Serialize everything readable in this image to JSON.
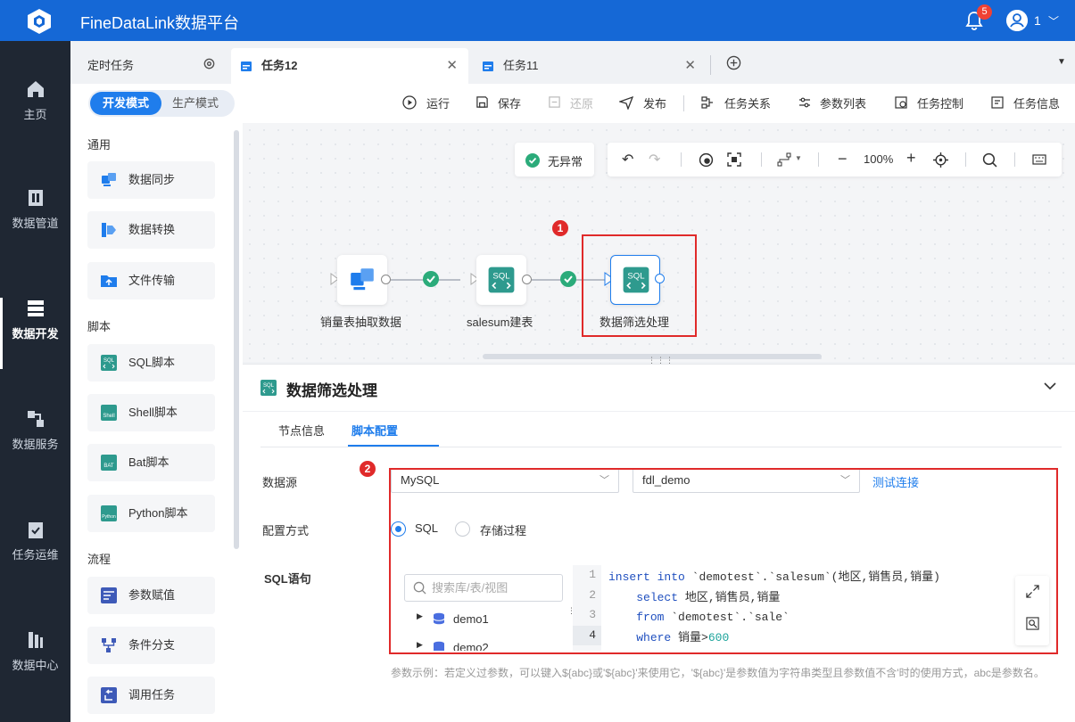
{
  "app": {
    "title": "FineDataLink数据平台",
    "badge": "5",
    "user": "1"
  },
  "nav": {
    "items": [
      {
        "label": "主页",
        "icon": "home-icon"
      },
      {
        "label": "数据管道",
        "icon": "pipeline-icon"
      },
      {
        "label": "数据开发",
        "icon": "dev-icon"
      },
      {
        "label": "数据服务",
        "icon": "service-icon"
      },
      {
        "label": "任务运维",
        "icon": "ops-icon"
      },
      {
        "label": "数据中心",
        "icon": "datacenter-icon"
      }
    ]
  },
  "tabs": {
    "scheduled": "定时任务",
    "items": [
      {
        "label": "任务12"
      },
      {
        "label": "任务11"
      }
    ]
  },
  "toolbar": {
    "mode_dev": "开发模式",
    "mode_prod": "生产模式",
    "run": "运行",
    "save": "保存",
    "restore": "还原",
    "publish": "发布",
    "relation": "任务关系",
    "params": "参数列表",
    "control": "任务控制",
    "info": "任务信息"
  },
  "palette": {
    "general": "通用",
    "script": "脚本",
    "flow": "流程",
    "general_items": [
      "数据同步",
      "数据转换",
      "文件传输"
    ],
    "script_items": [
      "SQL脚本",
      "Shell脚本",
      "Bat脚本",
      "Python脚本"
    ],
    "flow_items": [
      "参数赋值",
      "条件分支",
      "调用任务"
    ]
  },
  "canvas": {
    "status": "无异常",
    "zoom": "100%",
    "nodes": [
      "销量表抽取数据",
      "salesum建表",
      "数据筛选处理"
    ],
    "marker1": "1",
    "marker2": "2"
  },
  "panel": {
    "title": "数据筛选处理",
    "tabs": [
      "节点信息",
      "脚本配置"
    ],
    "datasource_label": "数据源",
    "datasource_type": "MySQL",
    "datasource_db": "fdl_demo",
    "test_link": "测试连接",
    "config_label": "配置方式",
    "option_sql": "SQL",
    "option_proc": "存储过程",
    "sql_label": "SQL语句",
    "search_placeholder": "搜索库/表/视图",
    "tree": [
      "demo1",
      "demo2"
    ],
    "code_line_numbers": [
      "1",
      "2",
      "3",
      "4"
    ],
    "hint": "参数示例：若定义过参数，可以键入${abc}或'${abc}'来使用它，'${abc}'是参数值为字符串类型且参数值不含'时的使用方式，abc是参数名。"
  }
}
